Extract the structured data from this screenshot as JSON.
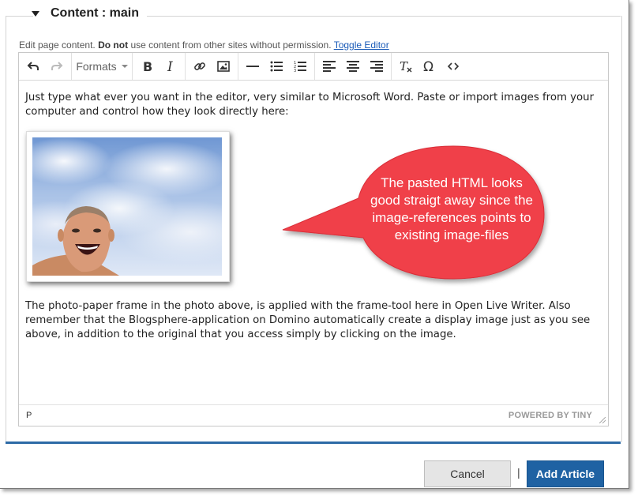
{
  "section": {
    "title": "Content : main"
  },
  "help": {
    "prefix": "Edit page content.",
    "strong": "Do not",
    "suffix": "use content from other sites without permission.",
    "toggle_link": "Toggle Editor"
  },
  "toolbar": {
    "formats_label": "Formats",
    "buttons": [
      "undo-icon",
      "redo-icon",
      "bold-icon",
      "italic-icon",
      "link-icon",
      "image-icon",
      "horizontal-rule-icon",
      "bullet-list-icon",
      "numbered-list-icon",
      "align-left-icon",
      "align-center-icon",
      "align-right-icon",
      "clear-formatting-icon",
      "special-character-icon",
      "source-code-icon"
    ]
  },
  "editor": {
    "paragraph1": "Just type what ever you want in the editor, very similar to Microsoft Word. Paste or import images from your computer and control how they look directly here:",
    "callout": "The pasted HTML looks good straigt away since the image-references points to existing image-files",
    "paragraph2": "The photo-paper frame in the photo above, is applied with the frame-tool here in Open Live Writer. Also remember that the Blogsphere-application on Domino automatically create a display image just as you see above, in addition to the original that you access simply by clicking on the image.",
    "status_path": "P",
    "powered_by": "POWERED BY TINY"
  },
  "actions": {
    "cancel_label": "Cancel",
    "separator": "|",
    "add_label": "Add Article"
  },
  "colors": {
    "primary_button": "#1f62a3",
    "callout": "#f0404a",
    "rule": "#2d6aa6"
  }
}
